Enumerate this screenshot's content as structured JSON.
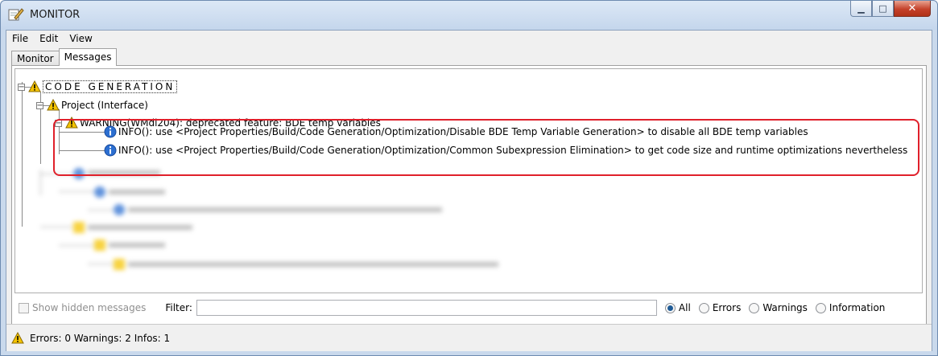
{
  "window": {
    "title": "MONITOR",
    "icon": "pencil-notepad-icon",
    "minimize_glyph": "▁",
    "maximize_glyph": "□",
    "close_glyph": "✕",
    "close_color": "#c4412a"
  },
  "menu": {
    "items": [
      "File",
      "Edit",
      "View"
    ]
  },
  "tabs": [
    {
      "label": "Monitor",
      "active": false
    },
    {
      "label": "Messages",
      "active": true
    }
  ],
  "tree": {
    "root": {
      "label": "CODE GENERATION",
      "icon": "warning-icon",
      "toggle": "−"
    },
    "project": {
      "label": "Project (Interface)",
      "icon": "warning-icon",
      "toggle": "−"
    },
    "warning": {
      "label": "WARNING(WMdl204): deprecated feature: BDE temp variables",
      "icon": "warning-icon",
      "toggle": "−"
    },
    "infos": [
      {
        "label": "INFO(): use <Project Properties/Build/Code Generation/Optimization/Disable BDE Temp Variable Generation> to disable all BDE temp variables",
        "icon": "info-icon"
      },
      {
        "label": "INFO(): use <Project Properties/Build/Code Generation/Optimization/Common Subexpression Elimination> to get code size and runtime optimizations nevertheless",
        "icon": "info-icon"
      }
    ],
    "highlight_color": "#e0202b"
  },
  "filter": {
    "show_hidden_label": "Show hidden messages",
    "show_hidden_checked": false,
    "filter_label": "Filter:",
    "filter_value": "",
    "options": [
      {
        "label": "All",
        "selected": true
      },
      {
        "label": "Errors",
        "selected": false
      },
      {
        "label": "Warnings",
        "selected": false
      },
      {
        "label": "Information",
        "selected": false
      }
    ]
  },
  "status": {
    "text": "Errors: 0   Warnings: 2   Infos: 1",
    "icon": "warning-icon"
  },
  "colors": {
    "warning": "#f5c400",
    "info": "#2c6fd1",
    "title_bar": "#c4d6ec"
  }
}
